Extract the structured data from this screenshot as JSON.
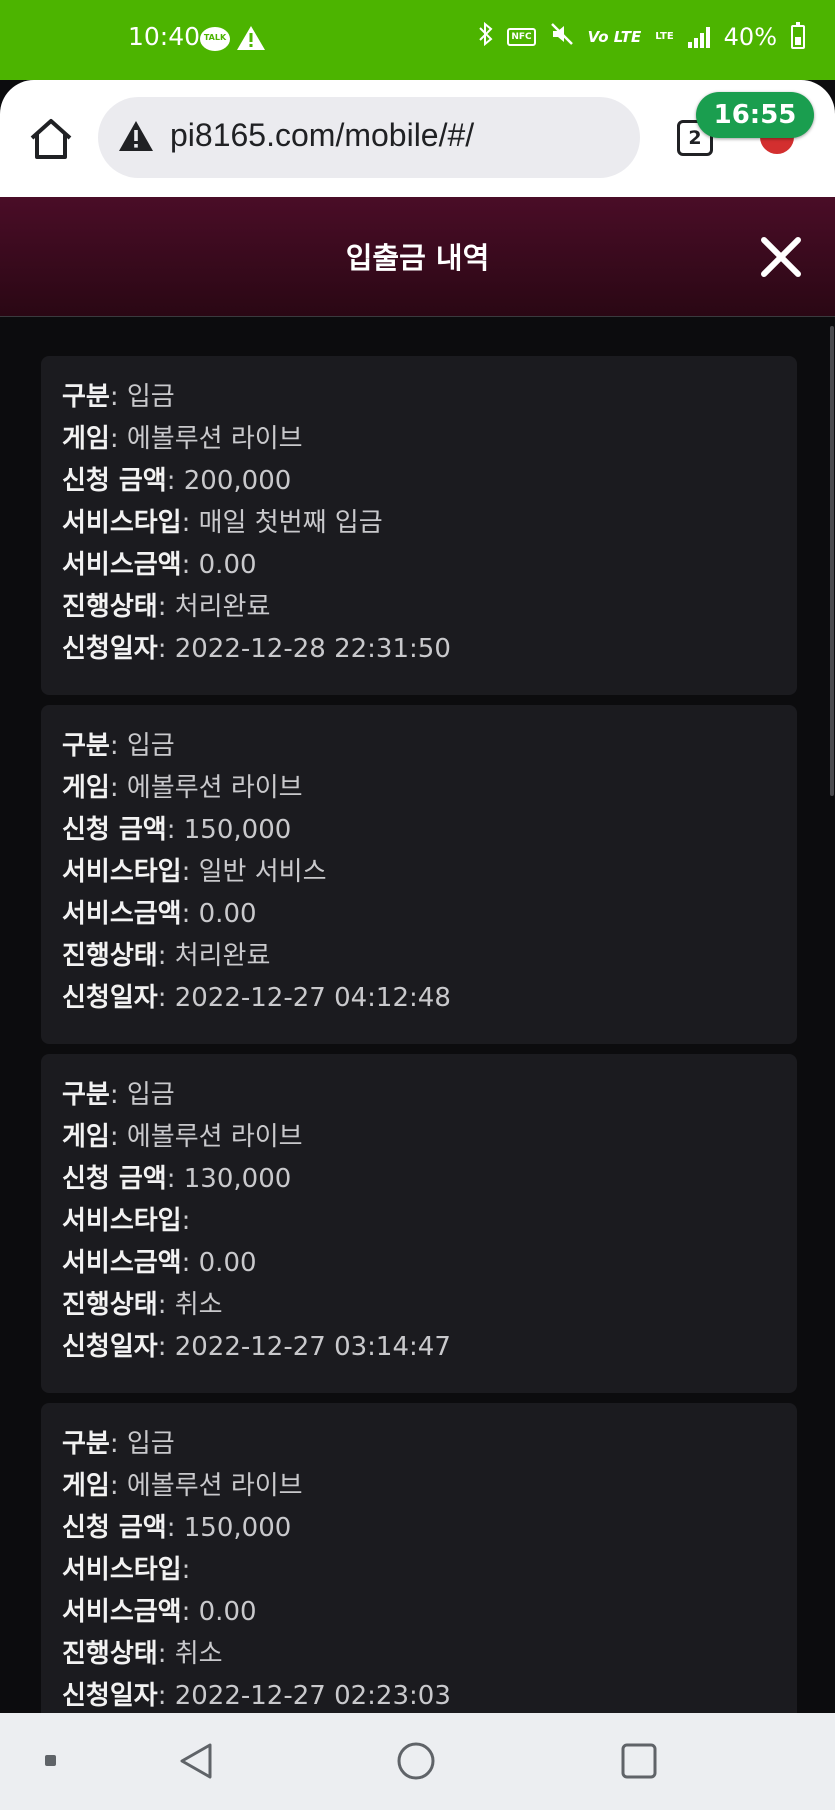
{
  "status_bar": {
    "time": "10:40",
    "talk_label": "TALK",
    "nfc_label": "NFC",
    "volte_label": "Vo LTE",
    "lte_label": "LTE",
    "battery": "40%"
  },
  "browser": {
    "url": "pi8165.com/mobile/#/",
    "tab_count": "2",
    "timer": "16:55"
  },
  "modal": {
    "title": "입출금 내역",
    "close_icon": "close-icon"
  },
  "labels": {
    "type": "구분",
    "game": "게임",
    "amount": "신청 금액",
    "service_type": "서비스타입",
    "service_amount": "서비스금액",
    "status": "진행상태",
    "date": "신청일자"
  },
  "records": [
    {
      "type": "입금",
      "game": "에볼루션 라이브",
      "amount": "200,000",
      "service_type": "매일 첫번째 입금",
      "service_amount": "0.00",
      "status": "처리완료",
      "date": "2022-12-28 22:31:50"
    },
    {
      "type": "입금",
      "game": "에볼루션 라이브",
      "amount": "150,000",
      "service_type": "일반 서비스",
      "service_amount": "0.00",
      "status": "처리완료",
      "date": "2022-12-27 04:12:48"
    },
    {
      "type": "입금",
      "game": "에볼루션 라이브",
      "amount": "130,000",
      "service_type": "",
      "service_amount": "0.00",
      "status": "취소",
      "date": "2022-12-27 03:14:47"
    },
    {
      "type": "입금",
      "game": "에볼루션 라이브",
      "amount": "150,000",
      "service_type": "",
      "service_amount": "0.00",
      "status": "취소",
      "date": "2022-12-27 02:23:03"
    }
  ],
  "colors": {
    "status_bar": "#4cb400",
    "modal_header": "#4a0d27",
    "card_bg": "#1b1b1f",
    "page_bg": "#0c0c0e",
    "timer_badge": "#1a9e4f"
  }
}
